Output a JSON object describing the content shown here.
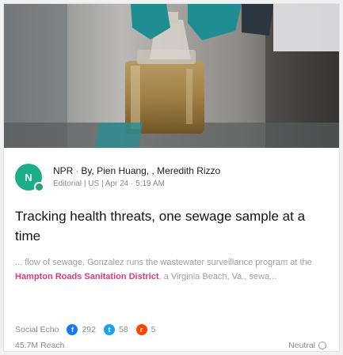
{
  "article": {
    "avatar_letter": "N",
    "source": "NPR",
    "byline": "By, Pien Huang, , Meredith Rizzo",
    "subline": "Editorial | US | Apr 24 · 5:19 AM",
    "title": "Tracking health threats, one sewage sample at a time",
    "snippet_before": "... flow of sewage. Gonzalez runs the wastewater surveillance program at the ",
    "snippet_highlight": "Hampton Roads Sanitation District",
    "snippet_after": ", a Virginia Beach, Va., sewa..."
  },
  "social": {
    "label": "Social Echo",
    "facebook_icon": "f",
    "facebook_count": "292",
    "twitter_icon": "t",
    "twitter_count": "58",
    "reddit_icon": "r",
    "reddit_count": "5"
  },
  "footer": {
    "reach": "45.7M Reach",
    "sentiment": "Neutral"
  },
  "colors": {
    "highlight": "#e0358a",
    "avatar": "#1cae88"
  }
}
